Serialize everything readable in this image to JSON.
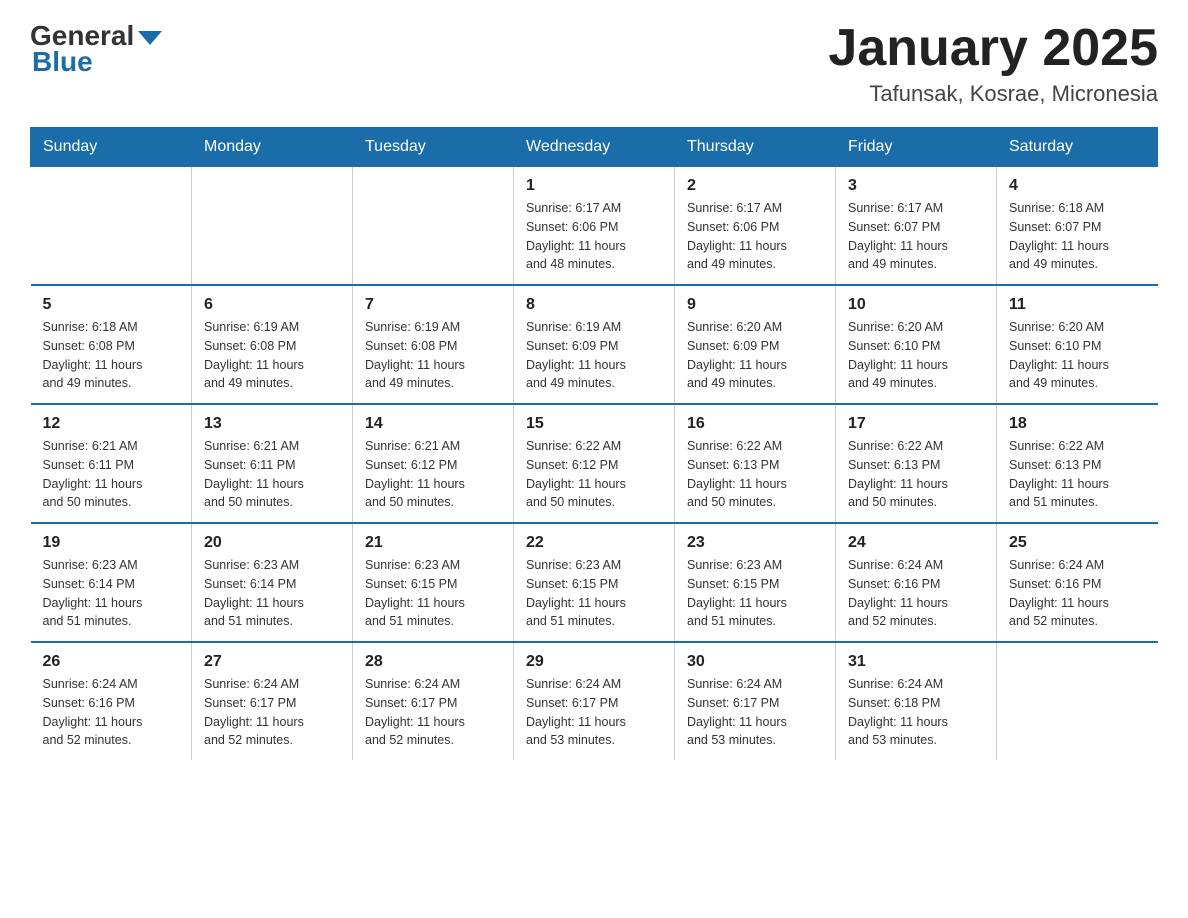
{
  "header": {
    "logo_general": "General",
    "logo_blue": "Blue",
    "month_title": "January 2025",
    "location": "Tafunsak, Kosrae, Micronesia"
  },
  "weekdays": [
    "Sunday",
    "Monday",
    "Tuesday",
    "Wednesday",
    "Thursday",
    "Friday",
    "Saturday"
  ],
  "weeks": [
    [
      {
        "day": "",
        "info": ""
      },
      {
        "day": "",
        "info": ""
      },
      {
        "day": "",
        "info": ""
      },
      {
        "day": "1",
        "info": "Sunrise: 6:17 AM\nSunset: 6:06 PM\nDaylight: 11 hours\nand 48 minutes."
      },
      {
        "day": "2",
        "info": "Sunrise: 6:17 AM\nSunset: 6:06 PM\nDaylight: 11 hours\nand 49 minutes."
      },
      {
        "day": "3",
        "info": "Sunrise: 6:17 AM\nSunset: 6:07 PM\nDaylight: 11 hours\nand 49 minutes."
      },
      {
        "day": "4",
        "info": "Sunrise: 6:18 AM\nSunset: 6:07 PM\nDaylight: 11 hours\nand 49 minutes."
      }
    ],
    [
      {
        "day": "5",
        "info": "Sunrise: 6:18 AM\nSunset: 6:08 PM\nDaylight: 11 hours\nand 49 minutes."
      },
      {
        "day": "6",
        "info": "Sunrise: 6:19 AM\nSunset: 6:08 PM\nDaylight: 11 hours\nand 49 minutes."
      },
      {
        "day": "7",
        "info": "Sunrise: 6:19 AM\nSunset: 6:08 PM\nDaylight: 11 hours\nand 49 minutes."
      },
      {
        "day": "8",
        "info": "Sunrise: 6:19 AM\nSunset: 6:09 PM\nDaylight: 11 hours\nand 49 minutes."
      },
      {
        "day": "9",
        "info": "Sunrise: 6:20 AM\nSunset: 6:09 PM\nDaylight: 11 hours\nand 49 minutes."
      },
      {
        "day": "10",
        "info": "Sunrise: 6:20 AM\nSunset: 6:10 PM\nDaylight: 11 hours\nand 49 minutes."
      },
      {
        "day": "11",
        "info": "Sunrise: 6:20 AM\nSunset: 6:10 PM\nDaylight: 11 hours\nand 49 minutes."
      }
    ],
    [
      {
        "day": "12",
        "info": "Sunrise: 6:21 AM\nSunset: 6:11 PM\nDaylight: 11 hours\nand 50 minutes."
      },
      {
        "day": "13",
        "info": "Sunrise: 6:21 AM\nSunset: 6:11 PM\nDaylight: 11 hours\nand 50 minutes."
      },
      {
        "day": "14",
        "info": "Sunrise: 6:21 AM\nSunset: 6:12 PM\nDaylight: 11 hours\nand 50 minutes."
      },
      {
        "day": "15",
        "info": "Sunrise: 6:22 AM\nSunset: 6:12 PM\nDaylight: 11 hours\nand 50 minutes."
      },
      {
        "day": "16",
        "info": "Sunrise: 6:22 AM\nSunset: 6:13 PM\nDaylight: 11 hours\nand 50 minutes."
      },
      {
        "day": "17",
        "info": "Sunrise: 6:22 AM\nSunset: 6:13 PM\nDaylight: 11 hours\nand 50 minutes."
      },
      {
        "day": "18",
        "info": "Sunrise: 6:22 AM\nSunset: 6:13 PM\nDaylight: 11 hours\nand 51 minutes."
      }
    ],
    [
      {
        "day": "19",
        "info": "Sunrise: 6:23 AM\nSunset: 6:14 PM\nDaylight: 11 hours\nand 51 minutes."
      },
      {
        "day": "20",
        "info": "Sunrise: 6:23 AM\nSunset: 6:14 PM\nDaylight: 11 hours\nand 51 minutes."
      },
      {
        "day": "21",
        "info": "Sunrise: 6:23 AM\nSunset: 6:15 PM\nDaylight: 11 hours\nand 51 minutes."
      },
      {
        "day": "22",
        "info": "Sunrise: 6:23 AM\nSunset: 6:15 PM\nDaylight: 11 hours\nand 51 minutes."
      },
      {
        "day": "23",
        "info": "Sunrise: 6:23 AM\nSunset: 6:15 PM\nDaylight: 11 hours\nand 51 minutes."
      },
      {
        "day": "24",
        "info": "Sunrise: 6:24 AM\nSunset: 6:16 PM\nDaylight: 11 hours\nand 52 minutes."
      },
      {
        "day": "25",
        "info": "Sunrise: 6:24 AM\nSunset: 6:16 PM\nDaylight: 11 hours\nand 52 minutes."
      }
    ],
    [
      {
        "day": "26",
        "info": "Sunrise: 6:24 AM\nSunset: 6:16 PM\nDaylight: 11 hours\nand 52 minutes."
      },
      {
        "day": "27",
        "info": "Sunrise: 6:24 AM\nSunset: 6:17 PM\nDaylight: 11 hours\nand 52 minutes."
      },
      {
        "day": "28",
        "info": "Sunrise: 6:24 AM\nSunset: 6:17 PM\nDaylight: 11 hours\nand 52 minutes."
      },
      {
        "day": "29",
        "info": "Sunrise: 6:24 AM\nSunset: 6:17 PM\nDaylight: 11 hours\nand 53 minutes."
      },
      {
        "day": "30",
        "info": "Sunrise: 6:24 AM\nSunset: 6:17 PM\nDaylight: 11 hours\nand 53 minutes."
      },
      {
        "day": "31",
        "info": "Sunrise: 6:24 AM\nSunset: 6:18 PM\nDaylight: 11 hours\nand 53 minutes."
      },
      {
        "day": "",
        "info": ""
      }
    ]
  ]
}
